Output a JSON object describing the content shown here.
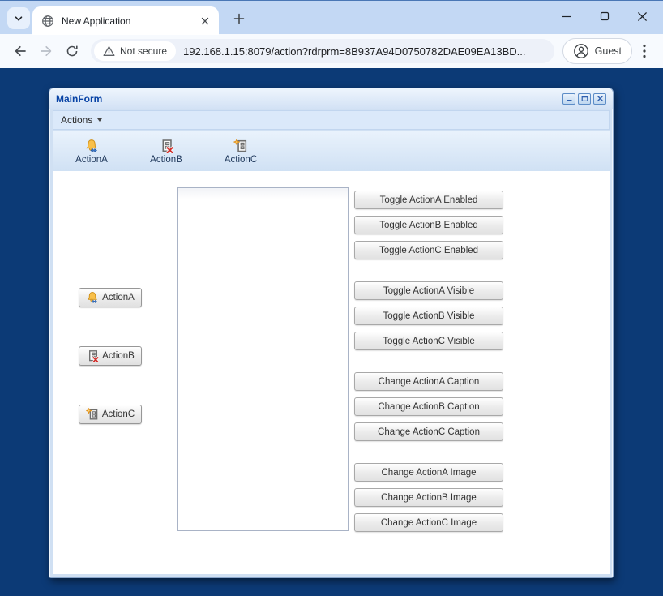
{
  "browser": {
    "tab_title": "New Application",
    "address": {
      "security_chip": "Not secure",
      "url": "192.168.1.15:8079/action?rdrprm=8B937A94D0750782DAE09EA13BD..."
    },
    "profile_button": "Guest"
  },
  "app": {
    "window_title": "MainForm",
    "menu_items": [
      {
        "label": "Actions"
      }
    ],
    "toolbar_items": [
      {
        "label": "ActionA",
        "icon": "bell-swap-icon"
      },
      {
        "label": "ActionB",
        "icon": "form-delete-icon"
      },
      {
        "label": "ActionC",
        "icon": "form-new-icon"
      }
    ],
    "action_buttons": [
      {
        "label": "ActionA",
        "icon": "bell-swap-icon"
      },
      {
        "label": "ActionB",
        "icon": "form-delete-icon"
      },
      {
        "label": "ActionC",
        "icon": "form-new-icon"
      }
    ],
    "control_groups": [
      {
        "buttons": [
          "Toggle ActionA Enabled",
          "Toggle ActionB Enabled",
          "Toggle ActionC Enabled"
        ]
      },
      {
        "buttons": [
          "Toggle ActionA Visible",
          "Toggle ActionB Visible",
          "Toggle ActionC Visible"
        ]
      },
      {
        "buttons": [
          "Change ActionA Caption",
          "Change ActionB Caption",
          "Change ActionC Caption"
        ]
      },
      {
        "buttons": [
          "Change ActionA Image",
          "Change ActionB Image",
          "Change ActionC Image"
        ]
      }
    ]
  },
  "colors": {
    "page_background": "#0c3a76",
    "browser_frame": "#c3d8f4",
    "form_frame": "#d0e0f3",
    "titlebar_text": "#0742a5",
    "toolbar_label": "#20395c",
    "bell_amber": "#f9c04a",
    "arrow_blue": "#3f7fd2",
    "delete_red": "#d1302c"
  }
}
